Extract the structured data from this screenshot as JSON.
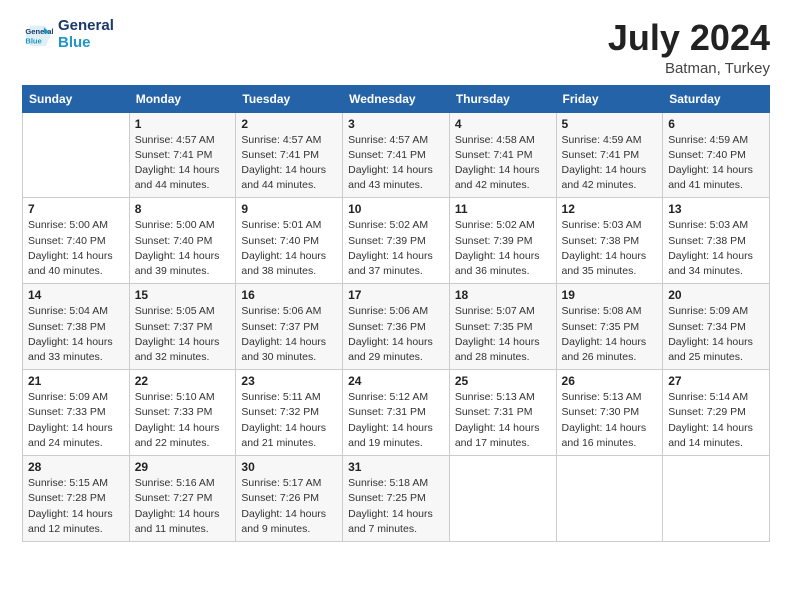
{
  "header": {
    "logo_line1": "General",
    "logo_line2": "Blue",
    "month": "July 2024",
    "location": "Batman, Turkey"
  },
  "weekdays": [
    "Sunday",
    "Monday",
    "Tuesday",
    "Wednesday",
    "Thursday",
    "Friday",
    "Saturday"
  ],
  "weeks": [
    [
      {
        "day": "",
        "sunrise": "",
        "sunset": "",
        "daylight": ""
      },
      {
        "day": "1",
        "sunrise": "Sunrise: 4:57 AM",
        "sunset": "Sunset: 7:41 PM",
        "daylight": "Daylight: 14 hours and 44 minutes."
      },
      {
        "day": "2",
        "sunrise": "Sunrise: 4:57 AM",
        "sunset": "Sunset: 7:41 PM",
        "daylight": "Daylight: 14 hours and 44 minutes."
      },
      {
        "day": "3",
        "sunrise": "Sunrise: 4:57 AM",
        "sunset": "Sunset: 7:41 PM",
        "daylight": "Daylight: 14 hours and 43 minutes."
      },
      {
        "day": "4",
        "sunrise": "Sunrise: 4:58 AM",
        "sunset": "Sunset: 7:41 PM",
        "daylight": "Daylight: 14 hours and 42 minutes."
      },
      {
        "day": "5",
        "sunrise": "Sunrise: 4:59 AM",
        "sunset": "Sunset: 7:41 PM",
        "daylight": "Daylight: 14 hours and 42 minutes."
      },
      {
        "day": "6",
        "sunrise": "Sunrise: 4:59 AM",
        "sunset": "Sunset: 7:40 PM",
        "daylight": "Daylight: 14 hours and 41 minutes."
      }
    ],
    [
      {
        "day": "7",
        "sunrise": "Sunrise: 5:00 AM",
        "sunset": "Sunset: 7:40 PM",
        "daylight": "Daylight: 14 hours and 40 minutes."
      },
      {
        "day": "8",
        "sunrise": "Sunrise: 5:00 AM",
        "sunset": "Sunset: 7:40 PM",
        "daylight": "Daylight: 14 hours and 39 minutes."
      },
      {
        "day": "9",
        "sunrise": "Sunrise: 5:01 AM",
        "sunset": "Sunset: 7:40 PM",
        "daylight": "Daylight: 14 hours and 38 minutes."
      },
      {
        "day": "10",
        "sunrise": "Sunrise: 5:02 AM",
        "sunset": "Sunset: 7:39 PM",
        "daylight": "Daylight: 14 hours and 37 minutes."
      },
      {
        "day": "11",
        "sunrise": "Sunrise: 5:02 AM",
        "sunset": "Sunset: 7:39 PM",
        "daylight": "Daylight: 14 hours and 36 minutes."
      },
      {
        "day": "12",
        "sunrise": "Sunrise: 5:03 AM",
        "sunset": "Sunset: 7:38 PM",
        "daylight": "Daylight: 14 hours and 35 minutes."
      },
      {
        "day": "13",
        "sunrise": "Sunrise: 5:03 AM",
        "sunset": "Sunset: 7:38 PM",
        "daylight": "Daylight: 14 hours and 34 minutes."
      }
    ],
    [
      {
        "day": "14",
        "sunrise": "Sunrise: 5:04 AM",
        "sunset": "Sunset: 7:38 PM",
        "daylight": "Daylight: 14 hours and 33 minutes."
      },
      {
        "day": "15",
        "sunrise": "Sunrise: 5:05 AM",
        "sunset": "Sunset: 7:37 PM",
        "daylight": "Daylight: 14 hours and 32 minutes."
      },
      {
        "day": "16",
        "sunrise": "Sunrise: 5:06 AM",
        "sunset": "Sunset: 7:37 PM",
        "daylight": "Daylight: 14 hours and 30 minutes."
      },
      {
        "day": "17",
        "sunrise": "Sunrise: 5:06 AM",
        "sunset": "Sunset: 7:36 PM",
        "daylight": "Daylight: 14 hours and 29 minutes."
      },
      {
        "day": "18",
        "sunrise": "Sunrise: 5:07 AM",
        "sunset": "Sunset: 7:35 PM",
        "daylight": "Daylight: 14 hours and 28 minutes."
      },
      {
        "day": "19",
        "sunrise": "Sunrise: 5:08 AM",
        "sunset": "Sunset: 7:35 PM",
        "daylight": "Daylight: 14 hours and 26 minutes."
      },
      {
        "day": "20",
        "sunrise": "Sunrise: 5:09 AM",
        "sunset": "Sunset: 7:34 PM",
        "daylight": "Daylight: 14 hours and 25 minutes."
      }
    ],
    [
      {
        "day": "21",
        "sunrise": "Sunrise: 5:09 AM",
        "sunset": "Sunset: 7:33 PM",
        "daylight": "Daylight: 14 hours and 24 minutes."
      },
      {
        "day": "22",
        "sunrise": "Sunrise: 5:10 AM",
        "sunset": "Sunset: 7:33 PM",
        "daylight": "Daylight: 14 hours and 22 minutes."
      },
      {
        "day": "23",
        "sunrise": "Sunrise: 5:11 AM",
        "sunset": "Sunset: 7:32 PM",
        "daylight": "Daylight: 14 hours and 21 minutes."
      },
      {
        "day": "24",
        "sunrise": "Sunrise: 5:12 AM",
        "sunset": "Sunset: 7:31 PM",
        "daylight": "Daylight: 14 hours and 19 minutes."
      },
      {
        "day": "25",
        "sunrise": "Sunrise: 5:13 AM",
        "sunset": "Sunset: 7:31 PM",
        "daylight": "Daylight: 14 hours and 17 minutes."
      },
      {
        "day": "26",
        "sunrise": "Sunrise: 5:13 AM",
        "sunset": "Sunset: 7:30 PM",
        "daylight": "Daylight: 14 hours and 16 minutes."
      },
      {
        "day": "27",
        "sunrise": "Sunrise: 5:14 AM",
        "sunset": "Sunset: 7:29 PM",
        "daylight": "Daylight: 14 hours and 14 minutes."
      }
    ],
    [
      {
        "day": "28",
        "sunrise": "Sunrise: 5:15 AM",
        "sunset": "Sunset: 7:28 PM",
        "daylight": "Daylight: 14 hours and 12 minutes."
      },
      {
        "day": "29",
        "sunrise": "Sunrise: 5:16 AM",
        "sunset": "Sunset: 7:27 PM",
        "daylight": "Daylight: 14 hours and 11 minutes."
      },
      {
        "day": "30",
        "sunrise": "Sunrise: 5:17 AM",
        "sunset": "Sunset: 7:26 PM",
        "daylight": "Daylight: 14 hours and 9 minutes."
      },
      {
        "day": "31",
        "sunrise": "Sunrise: 5:18 AM",
        "sunset": "Sunset: 7:25 PM",
        "daylight": "Daylight: 14 hours and 7 minutes."
      },
      {
        "day": "",
        "sunrise": "",
        "sunset": "",
        "daylight": ""
      },
      {
        "day": "",
        "sunrise": "",
        "sunset": "",
        "daylight": ""
      },
      {
        "day": "",
        "sunrise": "",
        "sunset": "",
        "daylight": ""
      }
    ]
  ]
}
